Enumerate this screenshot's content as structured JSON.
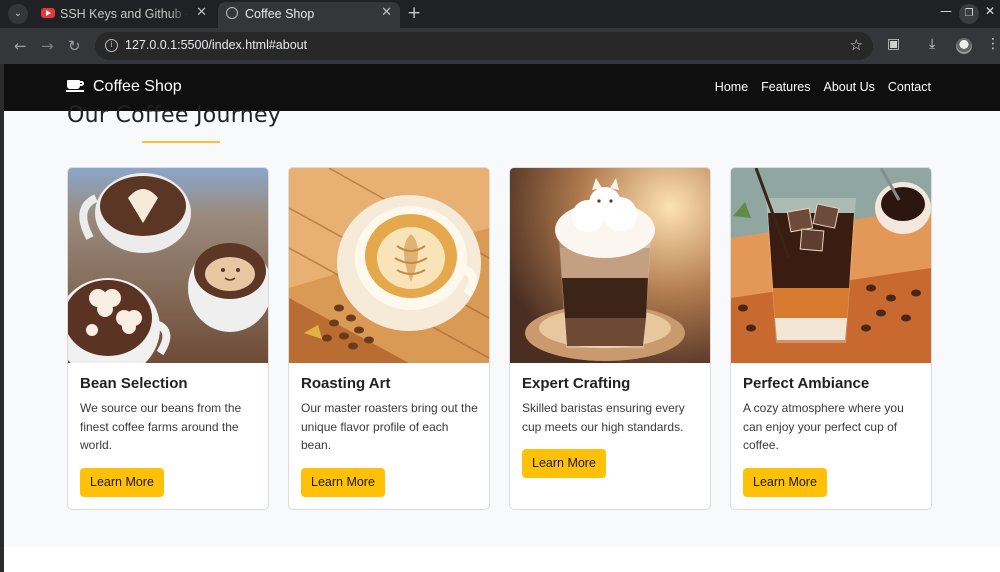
{
  "browser": {
    "tabs": [
      {
        "title": "SSH Keys and Github - Yo",
        "active": false,
        "icon": "youtube-icon"
      },
      {
        "title": "Coffee Shop",
        "active": true,
        "icon": "globe-icon"
      }
    ],
    "url": "127.0.0.1:5500/index.html#about"
  },
  "navbar": {
    "brand": "Coffee Shop",
    "brand_icon": "coffee-cup-icon",
    "links": [
      "Home",
      "Features",
      "About Us",
      "Contact"
    ]
  },
  "section": {
    "title": "Our Coffee Journey"
  },
  "cards": [
    {
      "title": "Bean Selection",
      "text": "We source our beans from the finest coffee farms around the world.",
      "button": "Learn More",
      "image": "latte-art-cups-illustration"
    },
    {
      "title": "Roasting Art",
      "text": "Our master roasters bring out the unique flavor profile of each bean.",
      "button": "Learn More",
      "image": "latte-with-beans-illustration"
    },
    {
      "title": "Expert Crafting",
      "text": "Skilled baristas ensuring every cup meets our high standards.",
      "button": "Learn More",
      "image": "layered-coffee-glass-illustration"
    },
    {
      "title": "Perfect Ambiance",
      "text": "A cozy atmosphere where you can enjoy your perfect cup of coffee.",
      "button": "Learn More",
      "image": "iced-coffee-illustration"
    }
  ],
  "colors": {
    "accent": "#ffc107",
    "navbar_bg": "#0f0f0f",
    "underline": "#ffbe2e"
  }
}
